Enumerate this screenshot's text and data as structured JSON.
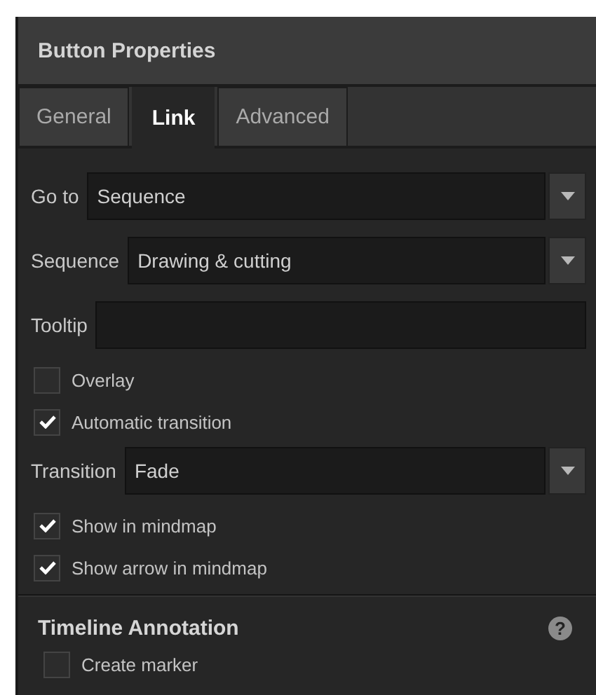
{
  "panel": {
    "title": "Button Properties"
  },
  "tabs": [
    {
      "label": "General",
      "selected": false
    },
    {
      "label": "Link",
      "selected": true
    },
    {
      "label": "Advanced",
      "selected": false
    }
  ],
  "fields": [
    {
      "kind": "dropdown",
      "label": "Go to",
      "value": "Sequence"
    },
    {
      "kind": "dropdown",
      "label": "Sequence",
      "value": "Drawing & cutting"
    },
    {
      "kind": "text",
      "label": "Tooltip"
    },
    {
      "kind": "checkbox",
      "label": "Overlay",
      "checked": false
    },
    {
      "kind": "checkbox",
      "label": "Automatic transition",
      "checked": true
    },
    {
      "kind": "dropdown",
      "label": "Transition",
      "value": "Fade"
    },
    {
      "kind": "checkbox",
      "label": "Show in mindmap",
      "checked": true
    },
    {
      "kind": "checkbox",
      "label": "Show arrow in mindmap",
      "checked": true
    }
  ],
  "section": {
    "title": "Timeline Annotation",
    "help": "?",
    "fields": [
      {
        "kind": "checkbox",
        "label": "Create marker",
        "checked": false
      }
    ]
  }
}
